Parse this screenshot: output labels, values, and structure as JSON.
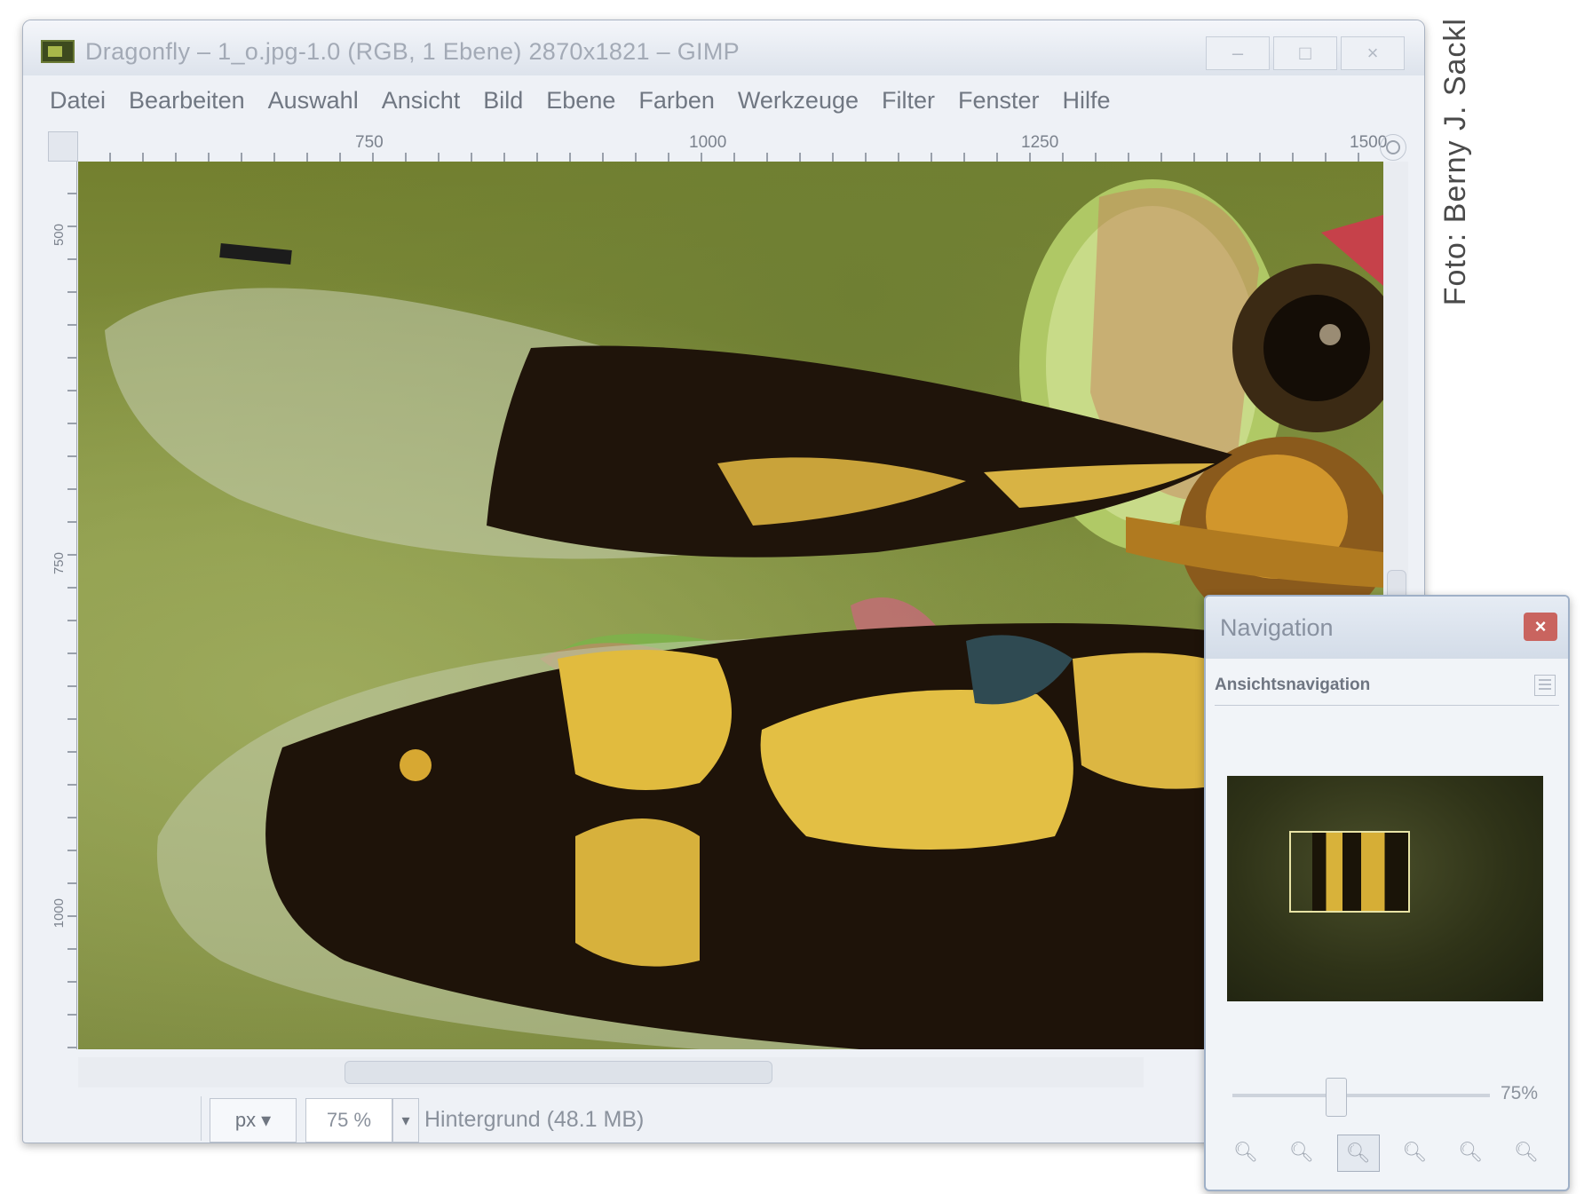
{
  "window": {
    "title": "Dragonfly – 1_o.jpg-1.0 (RGB, 1 Ebene) 2870x1821 – GIMP",
    "controls": [
      "–",
      "□",
      "×"
    ]
  },
  "menubar": {
    "items": [
      "Datei",
      "Bearbeiten",
      "Auswahl",
      "Ansicht",
      "Bild",
      "Ebene",
      "Farben",
      "Werkzeuge",
      "Filter",
      "Fenster",
      "Hilfe"
    ]
  },
  "ruler": {
    "top_labels": [
      "750",
      "1000",
      "1250",
      "1500"
    ],
    "left_labels": [
      "500",
      "750",
      "1000"
    ]
  },
  "statusbar": {
    "unit": "px",
    "zoom": "75 %",
    "info": "Hintergrund (48.1 MB)"
  },
  "navigation": {
    "title": "Navigation",
    "tab_header": "Ansichtsnavigation",
    "zoom_label": "75%",
    "zoom_slider_value": 0.4,
    "buttons": [
      "zoom-out-icon",
      "zoom-in-icon",
      "zoom-fit-icon",
      "zoom-100-icon",
      "zoom-shrink-icon",
      "zoom-expand-icon"
    ]
  },
  "credit": {
    "text": "Foto: Berny J. Sackl"
  }
}
